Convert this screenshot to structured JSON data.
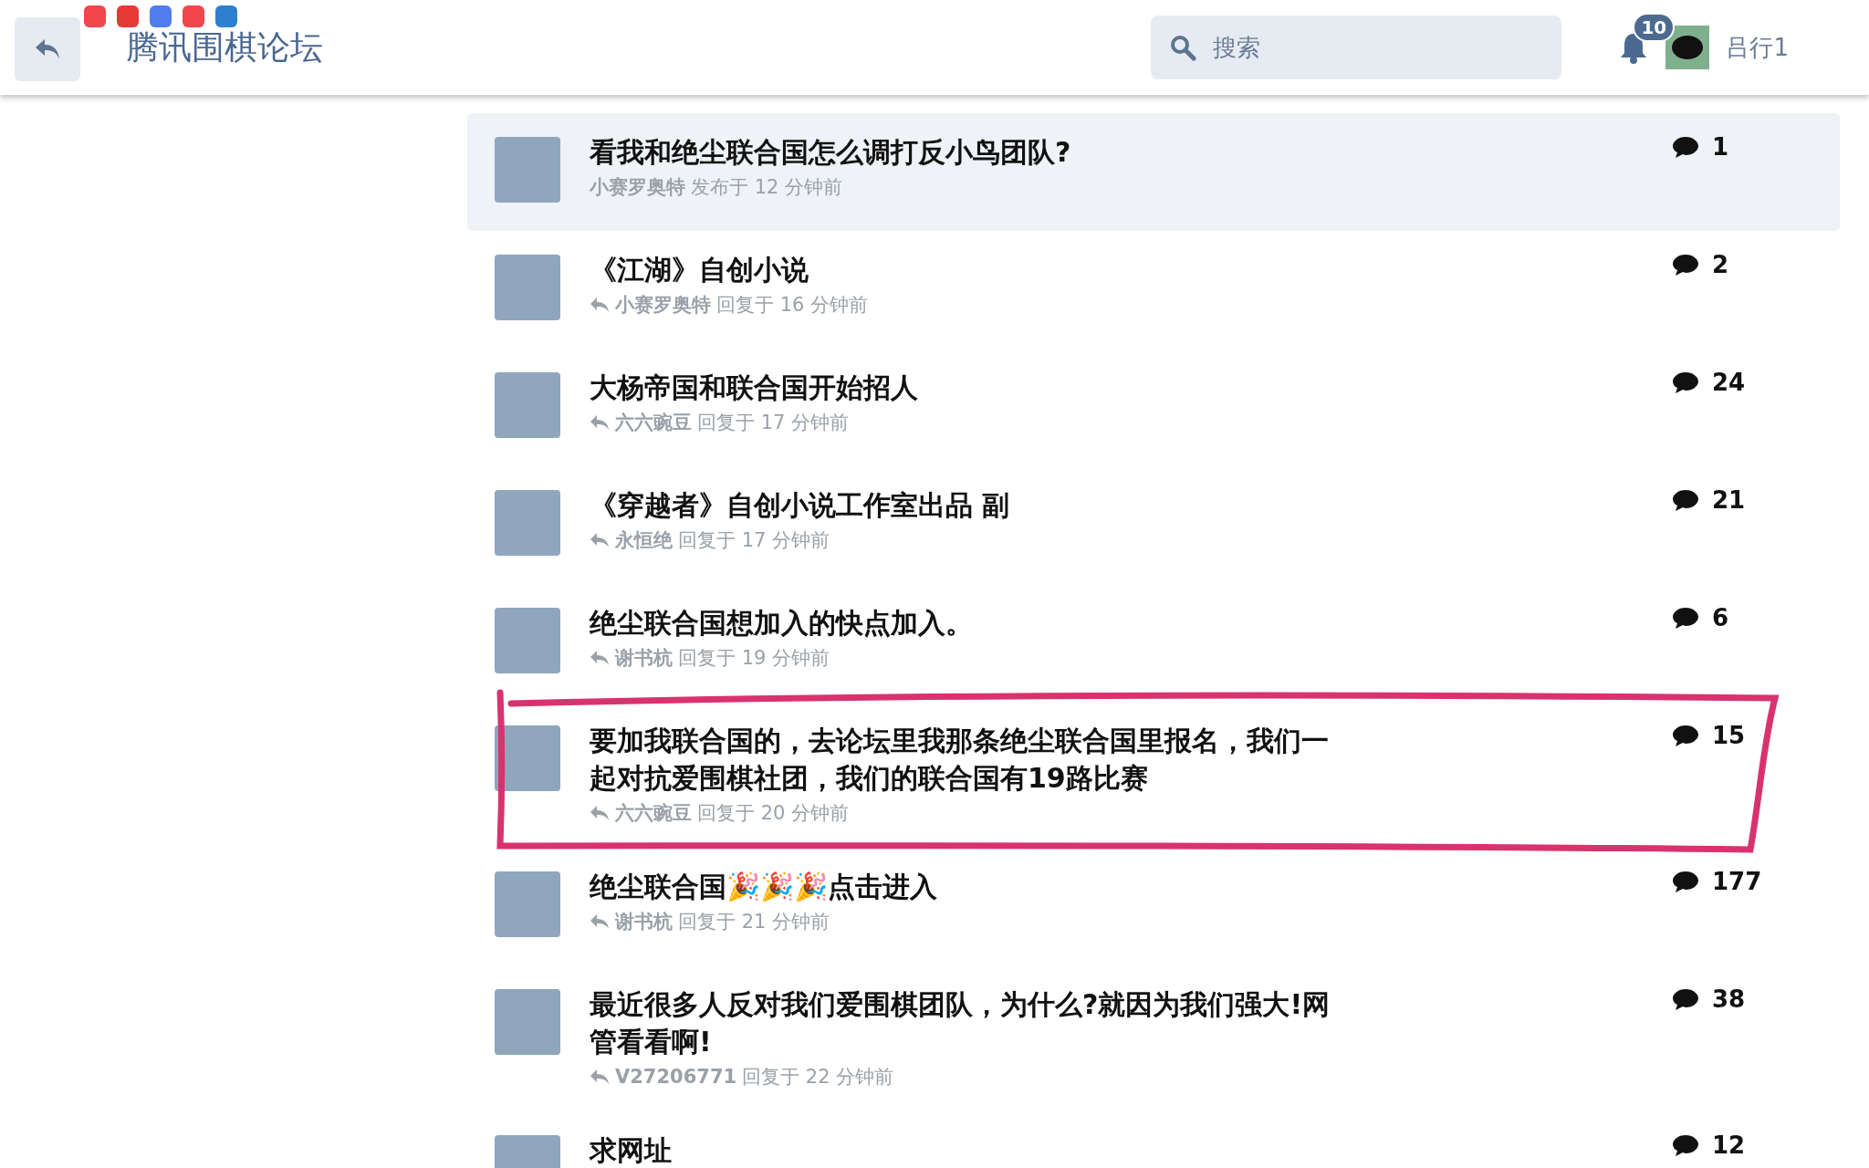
{
  "header": {
    "title": "腾讯围棋论坛",
    "search": {
      "placeholder": "搜索"
    },
    "notifications": {
      "count": "10"
    },
    "user": {
      "name": "吕行1"
    }
  },
  "status_icons": [
    {
      "color": "#f0464c"
    },
    {
      "color": "#e53935"
    },
    {
      "color": "#4f7df0"
    },
    {
      "color": "#f0464c"
    },
    {
      "color": "#2f7fd0"
    }
  ],
  "topics": [
    {
      "title": "看我和绝尘联合国怎么调打反小鸟团队?",
      "author": "小赛罗奥特",
      "kind": "posted",
      "action": "发布于",
      "time": "12 分钟前",
      "replies": "1",
      "selected": true,
      "circled": false
    },
    {
      "title": "《江湖》自创小说",
      "author": "小赛罗奥特",
      "kind": "replied",
      "action": "回复于",
      "time": "16 分钟前",
      "replies": "2",
      "selected": false,
      "circled": false
    },
    {
      "title": "大杨帝国和联合国开始招人",
      "author": "六六豌豆",
      "kind": "replied",
      "action": "回复于",
      "time": "17 分钟前",
      "replies": "24",
      "selected": false,
      "circled": false
    },
    {
      "title": "《穿越者》自创小说工作室出品 副",
      "author": "永恒绝",
      "kind": "replied",
      "action": "回复于",
      "time": "17 分钟前",
      "replies": "21",
      "selected": false,
      "circled": false
    },
    {
      "title": "绝尘联合国想加入的快点加入。",
      "author": "谢书杭",
      "kind": "replied",
      "action": "回复于",
      "time": "19 分钟前",
      "replies": "6",
      "selected": false,
      "circled": false
    },
    {
      "title": "要加我联合国的，去论坛里我那条绝尘联合国里报名，我们一起对抗爱围棋社团，我们的联合国有19路比赛",
      "author": "六六豌豆",
      "kind": "replied",
      "action": "回复于",
      "time": "20 分钟前",
      "replies": "15",
      "selected": false,
      "circled": true
    },
    {
      "title": "绝尘联合国🎉🎉🎉点击进入",
      "author": "谢书杭",
      "kind": "replied",
      "action": "回复于",
      "time": "21 分钟前",
      "replies": "177",
      "selected": false,
      "circled": false
    },
    {
      "title": "最近很多人反对我们爱围棋团队，为什么?就因为我们强大!网管看看啊!",
      "author": "V27206771",
      "kind": "replied",
      "action": "回复于",
      "time": "22 分钟前",
      "replies": "38",
      "selected": false,
      "circled": false
    },
    {
      "title": "求网址",
      "kind": "cut",
      "replies": "12",
      "selected": false,
      "circled": false
    }
  ]
}
